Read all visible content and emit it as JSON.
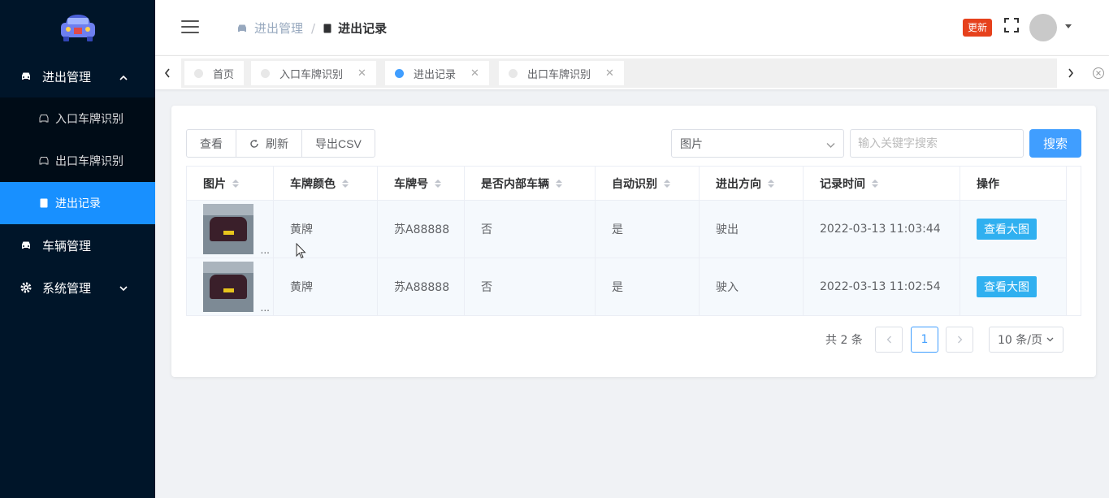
{
  "colors": {
    "sidebar_bg": "#001529",
    "active_item": "#1890ff",
    "primary": "#409eff",
    "update_badge": "#e6411c",
    "view_button": "#30b0f0"
  },
  "sidebar": {
    "logo_icon": "car-logo-icon",
    "groups": [
      {
        "label": "进出管理",
        "icon": "car-icon",
        "expanded": true,
        "children": [
          {
            "label": "入口车牌识别",
            "icon": "car-icon"
          },
          {
            "label": "出口车牌识别",
            "icon": "car-icon"
          },
          {
            "label": "进出记录",
            "icon": "document-icon",
            "active": true
          }
        ]
      },
      {
        "label": "车辆管理",
        "icon": "car-icon"
      },
      {
        "label": "系统管理",
        "icon": "gear-icon",
        "expanded": false
      }
    ]
  },
  "header": {
    "breadcrumb": [
      {
        "label": "进出管理",
        "icon": "car-icon"
      },
      {
        "label": "进出记录",
        "icon": "document-icon"
      }
    ],
    "breadcrumb_separator": "/",
    "update_label": "更新"
  },
  "tags": [
    {
      "label": "首页",
      "closable": false,
      "active": false
    },
    {
      "label": "入口车牌识别",
      "closable": true,
      "active": false
    },
    {
      "label": "进出记录",
      "closable": true,
      "active": true
    },
    {
      "label": "出口车牌识别",
      "closable": true,
      "active": false
    }
  ],
  "toolbar": {
    "view_label": "查看",
    "refresh_label": "刷新",
    "export_label": "导出CSV",
    "select_value": "图片",
    "search_placeholder": "输入关键字搜索",
    "search_label": "搜索"
  },
  "table": {
    "columns": [
      "图片",
      "车牌颜色",
      "车牌号",
      "是否内部车辆",
      "自动识别",
      "进出方向",
      "记录时间",
      "操作"
    ],
    "rows": [
      {
        "plate_color": "黄牌",
        "plate_number": "苏A88888",
        "is_internal": "否",
        "auto_recognized": "是",
        "direction": "驶出",
        "time": "2022-03-13 11:03:44",
        "action": "查看大图"
      },
      {
        "plate_color": "黄牌",
        "plate_number": "苏A88888",
        "is_internal": "否",
        "auto_recognized": "是",
        "direction": "驶入",
        "time": "2022-03-13 11:02:54",
        "action": "查看大图"
      }
    ],
    "thumb_ellipsis": "..."
  },
  "pagination": {
    "total_label": "共 2 条",
    "current_page": "1",
    "page_size_label": "10 条/页"
  }
}
